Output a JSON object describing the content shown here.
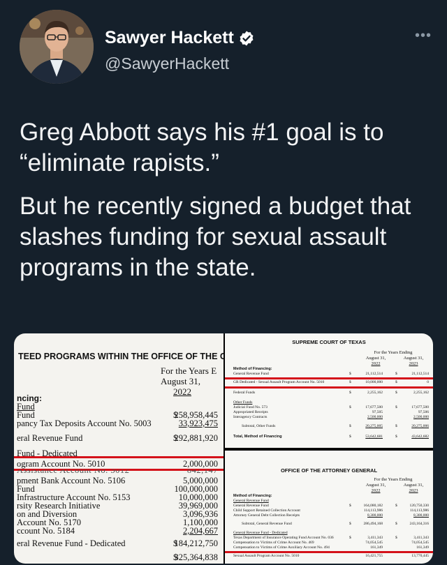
{
  "tweet": {
    "author_name": "Sawyer Hackett",
    "author_handle": "@SawyerHackett",
    "more_label": "•••",
    "paragraphs": [
      "Greg Abbott says his #1 goal is to “eliminate rapists.”",
      "But he recently signed a budget that slashes funding for sexual assault programs in the state."
    ]
  },
  "icons": {
    "verified": "verified-badge-icon",
    "more": "more-options-icon"
  },
  "colors": {
    "background": "#15202b",
    "text": "#ffffff",
    "handle": "#c7cdd3",
    "highlight_line": "#d4121a"
  },
  "left_doc": {
    "title": "TEED PROGRAMS WITHIN THE OFFICE OF THE GOV",
    "col_head": [
      "For the Years E",
      "August 31,",
      "2022"
    ],
    "rows": [
      {
        "label": "ncing:",
        "cur": "",
        "amt": "",
        "s2": ""
      },
      {
        "label": "Fund",
        "cur": "",
        "amt": "",
        "s2": ""
      },
      {
        "label": "Fund",
        "cur": "$",
        "amt": "258,958,445",
        "s2": "$"
      },
      {
        "label": "pancy Tax Deposits Account No. 5003",
        "cur": "",
        "amt": "33,923,475",
        "s2": ""
      },
      {
        "label": "eral Revenue Fund",
        "cur": "$",
        "amt": "292,881,920",
        "s2": "$"
      },
      {
        "label": "Fund - Dedicated",
        "cur": "",
        "amt": "",
        "s2": ""
      },
      {
        "label": "ogram Account No. 5010",
        "cur": "",
        "amt": "2,000,000",
        "s2": ""
      },
      {
        "label": "Assistance Account No. 5012",
        "cur": "",
        "amt": "842,147",
        "s2": ""
      },
      {
        "label": "pment Bank Account No. 5106",
        "cur": "",
        "amt": "5,000,000",
        "s2": ""
      },
      {
        "label": "Fund",
        "cur": "",
        "amt": "100,000,000",
        "s2": ""
      },
      {
        "label": "Infrastructure Account No. 5153",
        "cur": "",
        "amt": "10,000,000",
        "s2": ""
      },
      {
        "label": "rsity Research Initiative",
        "cur": "",
        "amt": "39,969,000",
        "s2": ""
      },
      {
        "label": "on and Diversion",
        "cur": "",
        "amt": "3,096,936",
        "s2": ""
      },
      {
        "label": "Account No. 5170",
        "cur": "",
        "amt": "1,100,000",
        "s2": ""
      },
      {
        "label": "ccount No. 5184",
        "cur": "",
        "amt": "2,204,667",
        "s2": ""
      },
      {
        "label": "eral Revenue Fund - Dedicated",
        "cur": "$",
        "amt": "184,212,750",
        "s2": "$"
      },
      {
        "label": "",
        "cur": "$",
        "amt": "325,364,838",
        "s2": "$"
      }
    ]
  },
  "right_doc_top": {
    "title": "SUPREME COURT OF TEXAS",
    "col_head": "For the Years Ending",
    "col1": [
      "August 31,",
      "2022"
    ],
    "col2": [
      "August 31,",
      "2023"
    ],
    "rows": [
      {
        "label": "Method of Financing:",
        "v1": "",
        "v2": "",
        "bold": true
      },
      {
        "label": "General Revenue Fund",
        "cur": "$",
        "v1": "21,112,514",
        "cur2": "$",
        "v2": "21,112,514"
      },
      {
        "label": "GR Dedicated - Sexual Assault Program Account No. 5010",
        "cur": "$",
        "v1": "10,000,000",
        "cur2": "$",
        "v2": "0"
      },
      {
        "label": "Federal Funds",
        "cur": "$",
        "v1": "2,255,162",
        "cur2": "$",
        "v2": "2,255,162"
      },
      {
        "label": "Other Funds",
        "v1": "",
        "v2": ""
      },
      {
        "label": "Judicial Fund No. 573",
        "cur": "$",
        "v1": "17,677,500",
        "cur2": "$",
        "v2": "17,677,500"
      },
      {
        "label": "Appropriated Receipts",
        "v1": "97,505",
        "v2": "97,506"
      },
      {
        "label": "Interagency Contracts",
        "v1": "2,500,000",
        "v2": "2,500,000"
      },
      {
        "label": "Subtotal, Other Funds",
        "cur": "$",
        "v1": "20,275,005",
        "cur2": "$",
        "v2": "20,275,006"
      },
      {
        "label": "Total, Method of Financing",
        "cur": "$",
        "v1": "53,642,681",
        "cur2": "$",
        "v2": "43,642,682"
      }
    ]
  },
  "right_doc_bottom": {
    "title": "OFFICE OF THE ATTORNEY GENERAL",
    "col_head": "For the Years Ending",
    "col1": [
      "August 31,",
      "2022"
    ],
    "col2": [
      "August 31,",
      "2023"
    ],
    "rows": [
      {
        "label": "Method of Financing:",
        "v1": "",
        "v2": ""
      },
      {
        "label": "General Revenue Fund",
        "v1": "",
        "v2": ""
      },
      {
        "label": "General Revenue Fund",
        "cur": "$",
        "v1": "164,080,182",
        "cur2": "$",
        "v2": "120,750,330"
      },
      {
        "label": "Child Support Retained Collection Account",
        "v1": "114,113,986",
        "v2": "114,113,986"
      },
      {
        "label": "Attorney General Debt Collection Receipts",
        "v1": "8,300,000",
        "v2": "8,300,000"
      },
      {
        "label": "Subtotal, General Revenue Fund",
        "cur": "$",
        "v1": "286,494,168",
        "cur2": "$",
        "v2": "243,164,316"
      },
      {
        "label": "General Revenue Fund - Dedicated",
        "v1": "",
        "v2": ""
      },
      {
        "label": "Texas Department of Insurance Operating Fund Account No. 036",
        "cur": "$",
        "v1": "3,411,343",
        "cur2": "$",
        "v2": "3,411,343"
      },
      {
        "label": "Compensation to Victims of Crime Account No. 469",
        "v1": "74,054,545",
        "v2": "74,054,545"
      },
      {
        "label": "Compensation to Victims of Crime Auxiliary Account No. 494",
        "v1": "161,349",
        "v2": "161,349"
      },
      {
        "label": "Sexual Assault Program Account No. 5010",
        "v1": "16,421,755",
        "v2": "13,770,445"
      }
    ]
  }
}
